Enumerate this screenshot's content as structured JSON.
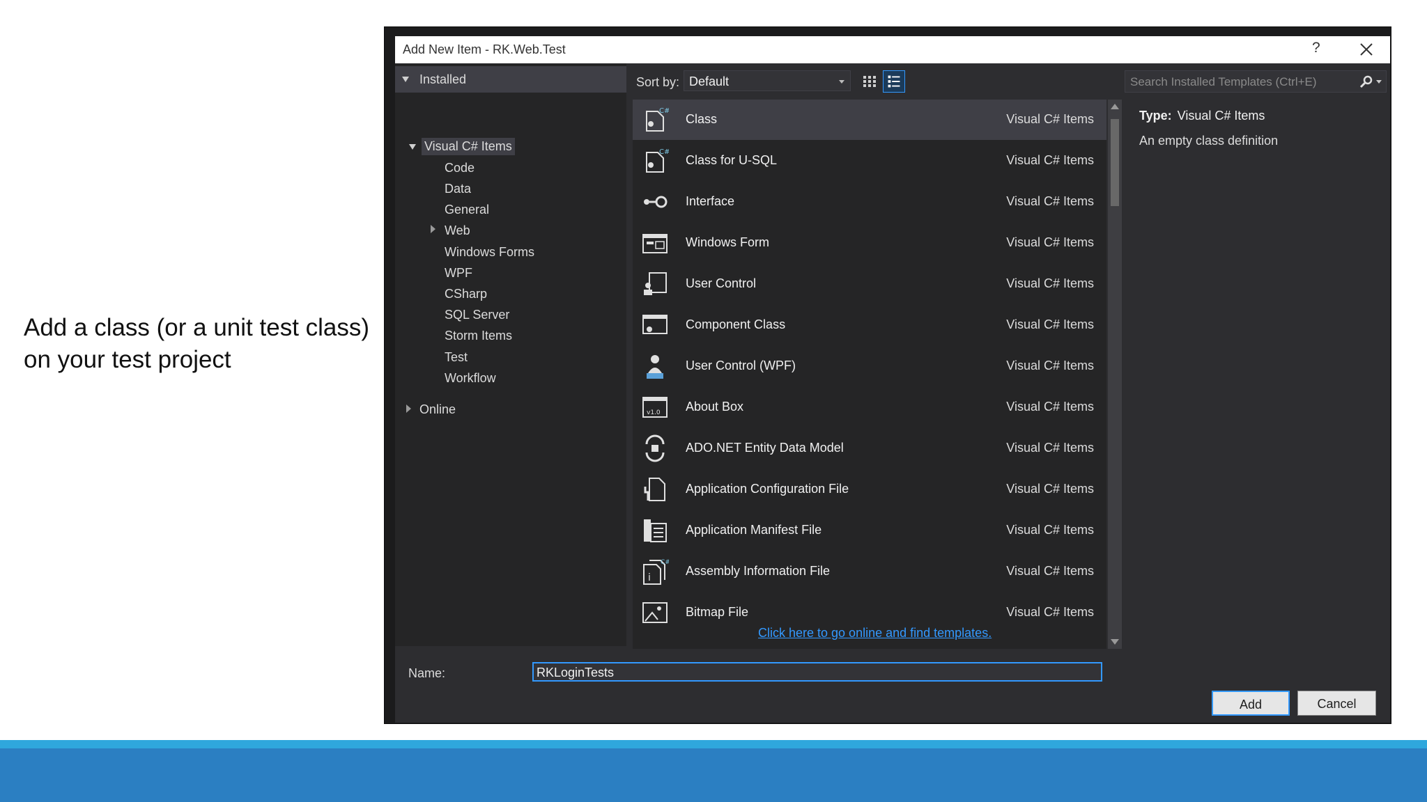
{
  "slide": {
    "caption_line1": "Add a class (or a unit test class)",
    "caption_line2": "on your test project",
    "band_colors": [
      "#2fa7dd",
      "#2b7fc2"
    ]
  },
  "dialog": {
    "title": "Add New Item - RK.Web.Test",
    "help_label": "?",
    "close_icon": "close-icon"
  },
  "tree": {
    "installed": "Installed",
    "root": "Visual C# Items",
    "children": [
      "Code",
      "Data",
      "General",
      "Web",
      "Windows Forms",
      "WPF",
      "CSharp",
      "SQL Server",
      "Storm Items",
      "Test",
      "Workflow"
    ],
    "online": "Online"
  },
  "toolbar": {
    "sort_label": "Sort by:",
    "sort_value": "Default",
    "search_placeholder": "Search Installed Templates (Ctrl+E)"
  },
  "templates": [
    {
      "name": "Class",
      "category": "Visual C# Items",
      "icon": "class-icon"
    },
    {
      "name": "Class for U-SQL",
      "category": "Visual C# Items",
      "icon": "class-icon"
    },
    {
      "name": "Interface",
      "category": "Visual C# Items",
      "icon": "interface-icon"
    },
    {
      "name": "Windows Form",
      "category": "Visual C# Items",
      "icon": "windows-form-icon"
    },
    {
      "name": "User Control",
      "category": "Visual C# Items",
      "icon": "user-control-icon"
    },
    {
      "name": "Component Class",
      "category": "Visual C# Items",
      "icon": "component-class-icon"
    },
    {
      "name": "User Control (WPF)",
      "category": "Visual C# Items",
      "icon": "user-control-wpf-icon"
    },
    {
      "name": "About Box",
      "category": "Visual C# Items",
      "icon": "about-box-icon"
    },
    {
      "name": "ADO.NET Entity Data Model",
      "category": "Visual C# Items",
      "icon": "entity-data-model-icon"
    },
    {
      "name": "Application Configuration File",
      "category": "Visual C# Items",
      "icon": "config-file-icon"
    },
    {
      "name": "Application Manifest File",
      "category": "Visual C# Items",
      "icon": "manifest-file-icon"
    },
    {
      "name": "Assembly Information File",
      "category": "Visual C# Items",
      "icon": "assembly-info-icon"
    },
    {
      "name": "Bitmap File",
      "category": "Visual C# Items",
      "icon": "bitmap-file-icon"
    }
  ],
  "details": {
    "type_label": "Type:",
    "type_value": "Visual C# Items",
    "description": "An empty class definition"
  },
  "online_link": "Click here to go online and find templates.",
  "footer": {
    "name_label": "Name:",
    "name_value": "RKLoginTests",
    "add_label": "Add",
    "cancel_label": "Cancel"
  },
  "colors": {
    "dialog_bg": "#2d2d30",
    "panel_bg": "#252526",
    "selection": "#3f3f46",
    "accent": "#3399ff"
  }
}
